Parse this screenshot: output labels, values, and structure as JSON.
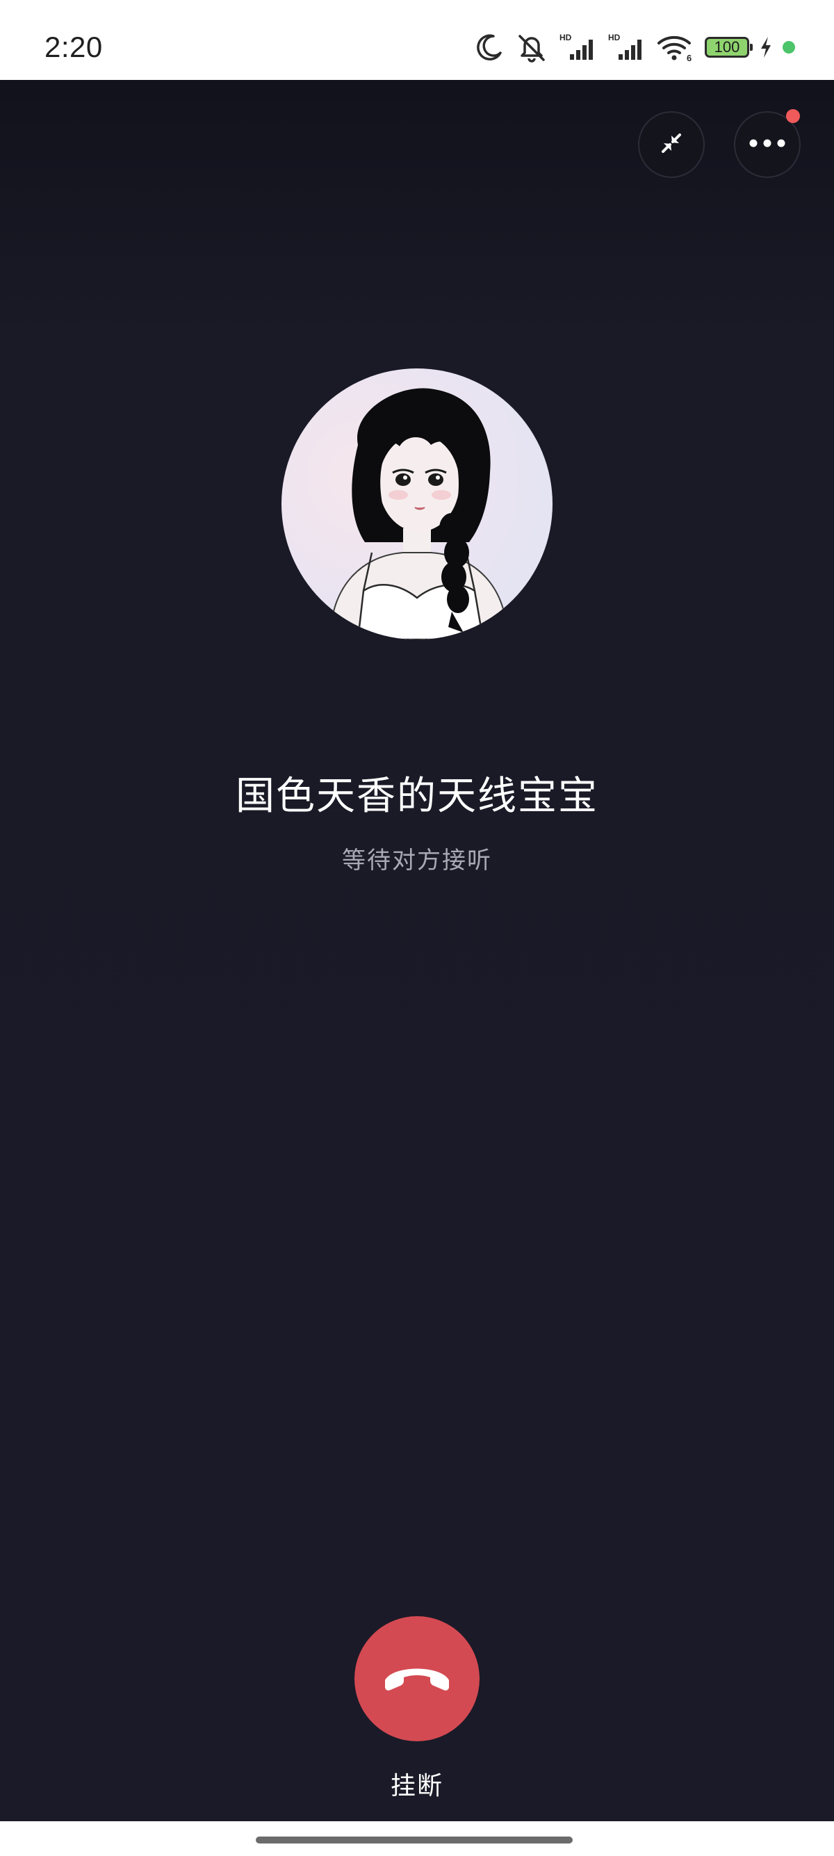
{
  "status_bar": {
    "time": "2:20",
    "battery_level": "100",
    "icons": [
      "moon-icon",
      "mute-icon",
      "signal-hd-icon",
      "signal-hd-icon",
      "wifi-icon",
      "battery-icon",
      "charging-icon",
      "green-dot-indicator"
    ],
    "signal_label_1": "HD",
    "signal_label_2": "HD",
    "wifi_label": "6"
  },
  "call": {
    "contact_name": "国色天香的天线宝宝",
    "status_text": "等待对方接听",
    "hangup_label": "挂断",
    "minimize_icon": "minimize-arrows-icon",
    "more_icon": "more-dots-icon",
    "has_notification": true
  },
  "colors": {
    "background": "#1b1a28",
    "hangup": "#d44a52",
    "notification": "#ef5a5a",
    "battery_fill": "#8fd36e"
  }
}
